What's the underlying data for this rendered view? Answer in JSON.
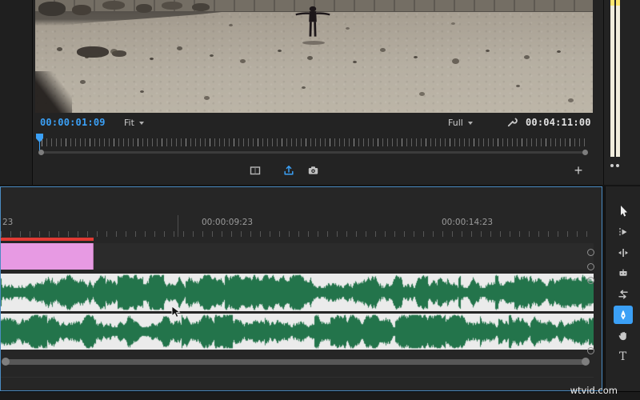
{
  "colors": {
    "accent_blue": "#3ba0f6",
    "focus_border": "#4a8bc2",
    "clip_pink": "#e79ae3",
    "render_red": "#e03a34",
    "waveform_green": "#23744b",
    "waveform_bg": "#ebebeb",
    "meter_yellow": "#ffe76e",
    "meter_body": "#f2eedd"
  },
  "monitor": {
    "current_timecode": "00:00:01:09",
    "zoom_level": "Fit",
    "playback_resolution": "Full",
    "duration_timecode": "00:04:11:00",
    "add_panel_button": "+",
    "button_icons": [
      "comparison-view-icon",
      "export-icon",
      "camera-icon",
      "plus-icon",
      "wrench-icon",
      "chevron-down-icon"
    ]
  },
  "timeline": {
    "ruler_labels": {
      "partial": "23",
      "label1": "00:00:09:23",
      "label2": "00:00:14:23"
    },
    "waveform_seed": 13
  },
  "tools": {
    "type_tool_glyph": "T",
    "items": [
      {
        "id": "selection-tool",
        "active": false
      },
      {
        "id": "track-select-forward-tool",
        "active": false
      },
      {
        "id": "ripple-edit-tool",
        "active": false
      },
      {
        "id": "razor-tool",
        "active": false
      },
      {
        "id": "slip-tool",
        "active": false
      },
      {
        "id": "pen-tool",
        "active": true
      },
      {
        "id": "hand-tool",
        "active": false
      },
      {
        "id": "type-tool",
        "active": false
      }
    ]
  },
  "watermark": "wtvid.com"
}
